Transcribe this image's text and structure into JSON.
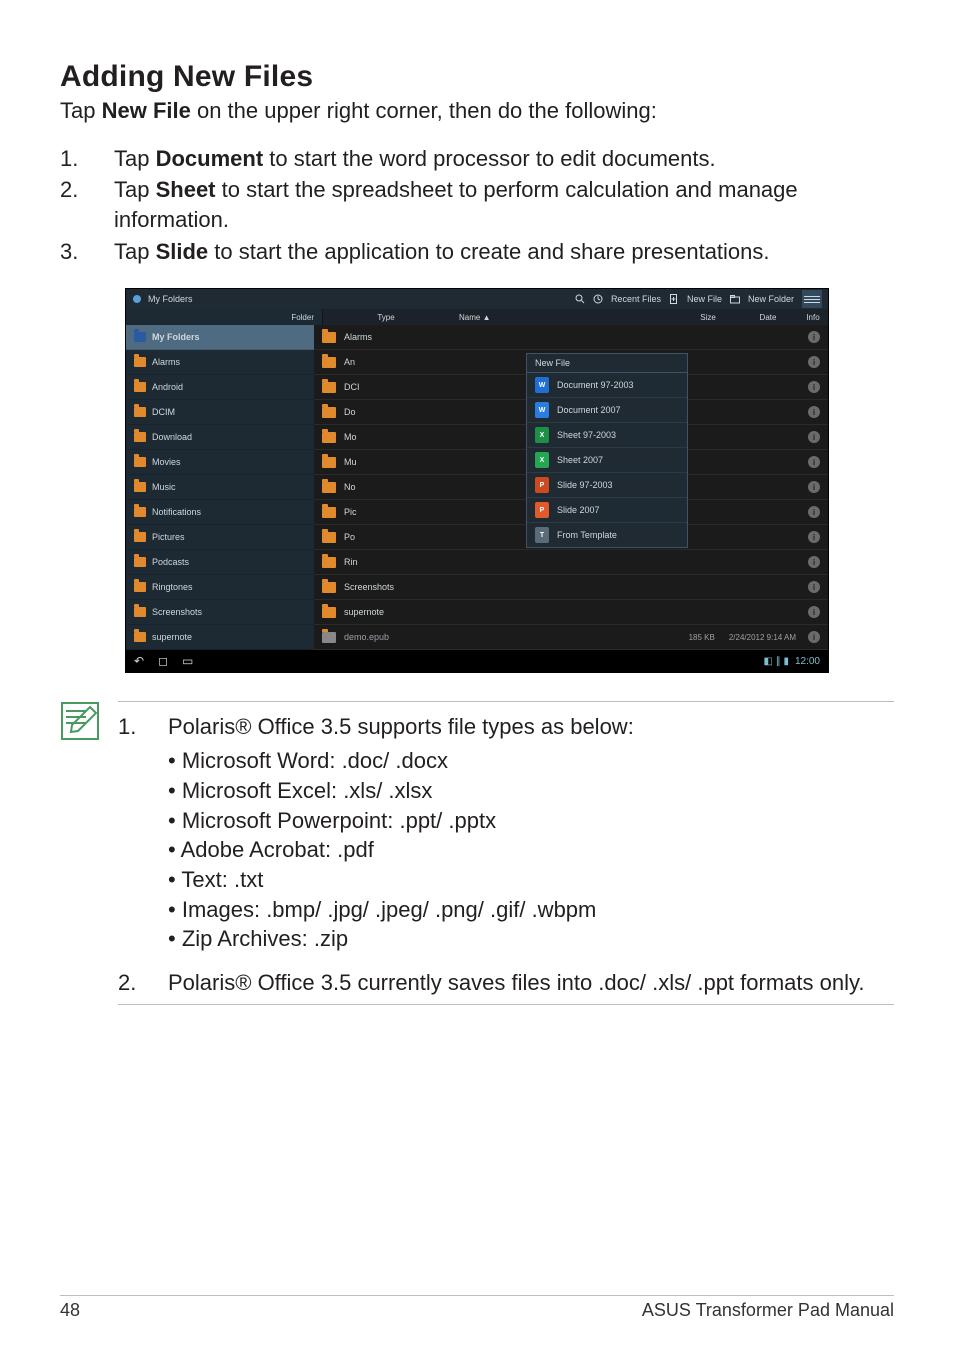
{
  "heading": "Adding New Files",
  "intro_pre": "Tap ",
  "intro_bold": "New File",
  "intro_post": " on the upper right corner, then do the following:",
  "steps": [
    {
      "pre": "Tap ",
      "bold": "Document",
      "post": " to start the word processor to edit documents."
    },
    {
      "pre": "Tap ",
      "bold": "Sheet",
      "post": " to start the spreadsheet to perform calculation and manage information."
    },
    {
      "pre": "Tap ",
      "bold": "Slide",
      "post": " to start the application to create and share presentations."
    }
  ],
  "screenshot": {
    "topbar": {
      "title": "My Folders",
      "recent": "Recent Files",
      "newfile": "New File",
      "newfolder": "New Folder"
    },
    "tabs": {
      "folder": "Folder",
      "type": "Type",
      "name": "Name ▲",
      "size": "Size",
      "date": "Date",
      "info": "Info"
    },
    "sidebar": [
      {
        "name": "My Folders",
        "first": true
      },
      {
        "name": "Alarms"
      },
      {
        "name": "Android"
      },
      {
        "name": "DCIM"
      },
      {
        "name": "Download"
      },
      {
        "name": "Movies"
      },
      {
        "name": "Music"
      },
      {
        "name": "Notifications"
      },
      {
        "name": "Pictures"
      },
      {
        "name": "Podcasts"
      },
      {
        "name": "Ringtones"
      },
      {
        "name": "Screenshots"
      },
      {
        "name": "supernote"
      }
    ],
    "callout": {
      "title": "New File",
      "items": [
        {
          "kind": "doc",
          "label": "Document 97-2003"
        },
        {
          "kind": "doc07",
          "label": "Document 2007"
        },
        {
          "kind": "xls",
          "label": "Sheet 97-2003"
        },
        {
          "kind": "xls07",
          "label": "Sheet 2007"
        },
        {
          "kind": "ppt",
          "label": "Slide 97-2003"
        },
        {
          "kind": "ppt07",
          "label": "Slide 2007"
        },
        {
          "kind": "tpl",
          "label": "From Template"
        }
      ]
    },
    "mainrows": [
      {
        "label": "Alarms"
      },
      {
        "label": "An"
      },
      {
        "label": "DCI"
      },
      {
        "label": "Do"
      },
      {
        "label": "Mo"
      },
      {
        "label": "Mu"
      },
      {
        "label": "No"
      },
      {
        "label": "Pic"
      },
      {
        "label": "Po"
      },
      {
        "label": "Rin"
      },
      {
        "label": "Screenshots"
      },
      {
        "label": "supernote"
      },
      {
        "label": "demo.epub",
        "file": true,
        "size": "185 KB",
        "date": "2/24/2012\n9:14 AM"
      }
    ],
    "bottombar": {
      "back": "↶",
      "home": "◻",
      "recent": "▭",
      "clock": "12:00",
      "status": "◧ ∥ ▮"
    }
  },
  "notes": {
    "n1_intro": "Polaris® Office 3.5 supports file types as below:",
    "filetypes": [
      "Microsoft Word: .doc/ .docx",
      "Microsoft Excel: .xls/ .xlsx",
      "Microsoft Powerpoint: .ppt/ .pptx",
      "Adobe Acrobat: .pdf",
      "Text: .txt",
      "Images: .bmp/ .jpg/ .jpeg/ .png/ .gif/ .wbpm",
      "Zip Archives: .zip"
    ],
    "n2": "Polaris® Office 3.5 currently saves files into .doc/ .xls/ .ppt formats only."
  },
  "footer": {
    "page": "48",
    "manual": "ASUS Transformer Pad Manual"
  }
}
